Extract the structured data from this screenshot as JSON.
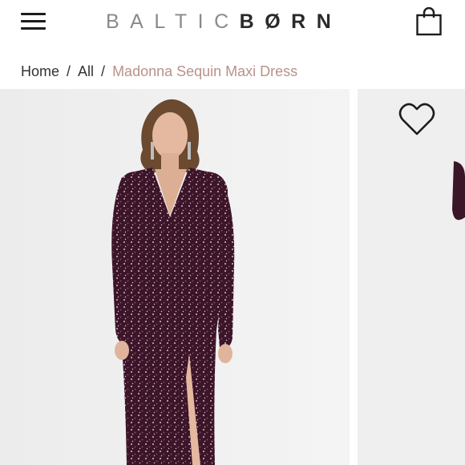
{
  "header": {
    "logo_light": "BALTIC",
    "logo_dark": "BØRN"
  },
  "breadcrumb": {
    "items": [
      "Home",
      "All"
    ],
    "separator": "/",
    "current": "Madonna Sequin Maxi Dress"
  },
  "product": {
    "image_alt": "Model wearing the Madonna Sequin Maxi Dress in plum sequins"
  },
  "colors": {
    "accent": "#b89288",
    "dress": "#3b1528",
    "background": "#efefef"
  },
  "icons": {
    "menu": "hamburger-menu-icon",
    "cart": "shopping-bag-icon",
    "wishlist": "heart-outline-icon"
  }
}
